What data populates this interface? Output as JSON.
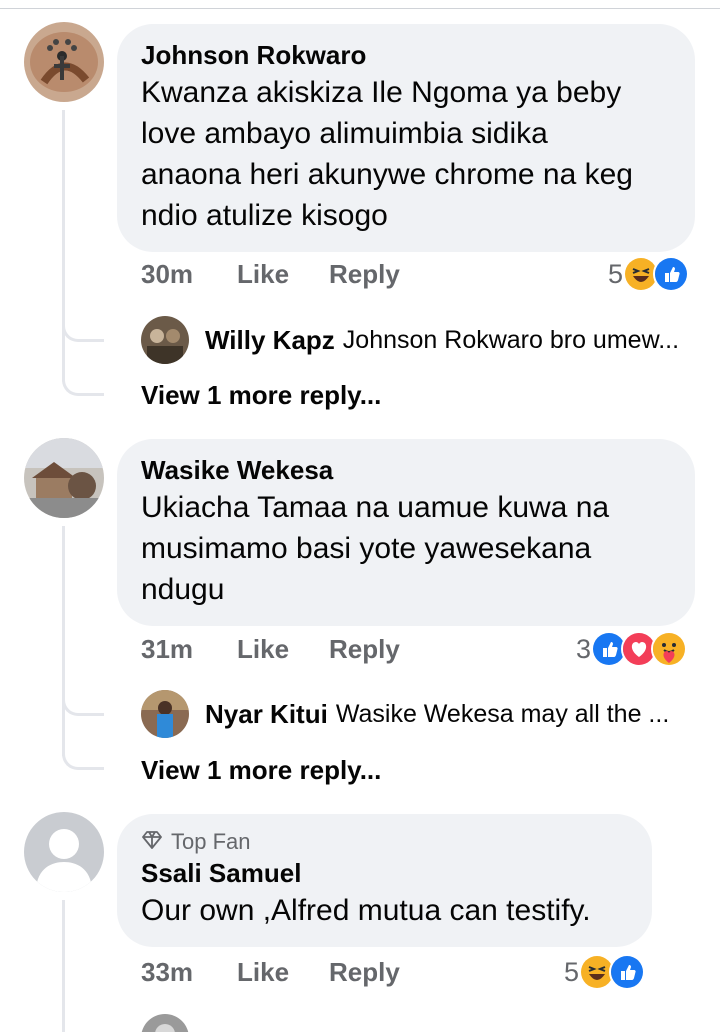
{
  "comments": [
    {
      "author": "Johnson Rokwaro",
      "text_lines": [
        "Kwanza akiskiza Ile Ngoma ya beby",
        "love ambayo alimuimbia sidika",
        "anaona heri akunywe chrome na keg",
        "ndio atulize kisogo"
      ],
      "time": "30m",
      "like_label": "Like",
      "reply_label": "Reply",
      "reaction_count": "5",
      "reactions": [
        "haha-icon",
        "like-icon"
      ],
      "reply": {
        "author": "Willy Kapz",
        "text": "Johnson Rokwaro bro umew..."
      },
      "view_more": "View 1 more reply..."
    },
    {
      "author": "Wasike Wekesa",
      "text_lines": [
        "Ukiacha Tamaa na uamue kuwa na",
        "musimamo basi yote yawesekana",
        "ndugu"
      ],
      "time": "31m",
      "like_label": "Like",
      "reply_label": "Reply",
      "reaction_count": "3",
      "reactions": [
        "like-icon",
        "love-icon",
        "care-icon"
      ],
      "reply": {
        "author": "Nyar Kitui",
        "text": "Wasike Wekesa may all the ..."
      },
      "view_more": "View 1 more reply..."
    },
    {
      "badge": "Top Fan",
      "author": "Ssali Samuel",
      "text_lines": [
        "Our own ,Alfred mutua can testify."
      ],
      "time": "33m",
      "like_label": "Like",
      "reply_label": "Reply",
      "reaction_count": "5",
      "reactions": [
        "haha-icon",
        "like-icon"
      ]
    }
  ],
  "colors": {
    "bubble": "#f0f2f5",
    "meta_text": "#65676b",
    "like_blue": "#1877f2",
    "love_red": "#f33e58",
    "haha_yellow": "#f7b125"
  }
}
